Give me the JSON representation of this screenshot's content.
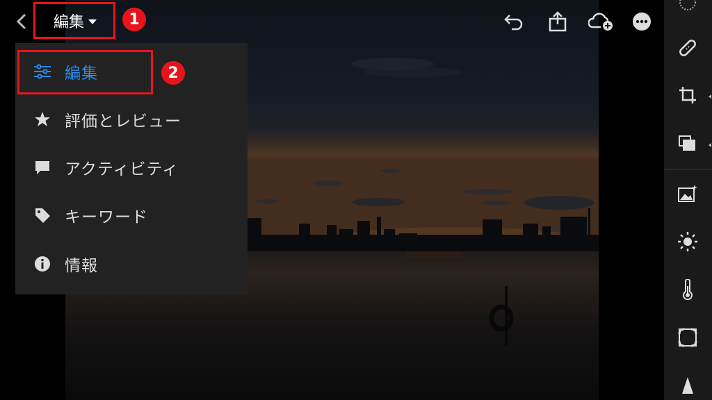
{
  "header": {
    "back_icon": "chevron-left-icon",
    "title": "編集",
    "title_caret_icon": "caret-down-icon",
    "actions": [
      {
        "name": "undo-button",
        "icon": "undo-icon"
      },
      {
        "name": "share-button",
        "icon": "share-icon"
      },
      {
        "name": "cloud-add-button",
        "icon": "cloud-add-icon"
      },
      {
        "name": "more-button",
        "icon": "more-icon"
      }
    ]
  },
  "annotations": {
    "step1": "1",
    "step2": "2",
    "highlight_color": "#e8141c"
  },
  "menu": {
    "items": [
      {
        "label": "編集",
        "icon": "sliders-icon",
        "active": true
      },
      {
        "label": "評価とレビュー",
        "icon": "star-icon",
        "active": false
      },
      {
        "label": "アクティビティ",
        "icon": "comment-icon",
        "active": false
      },
      {
        "label": "キーワード",
        "icon": "tag-icon",
        "active": false
      },
      {
        "label": "情報",
        "icon": "info-icon",
        "active": false
      }
    ],
    "active_color": "#2a8cf0"
  },
  "right_toolbar": {
    "tools": [
      {
        "name": "presets",
        "icon": "presets-icon"
      },
      {
        "name": "healing",
        "icon": "bandage-icon"
      },
      {
        "name": "crop",
        "icon": "crop-icon"
      },
      {
        "name": "versions",
        "icon": "versions-icon"
      },
      {
        "name": "auto",
        "icon": "auto-image-icon"
      },
      {
        "name": "light",
        "icon": "sun-icon"
      },
      {
        "name": "color",
        "icon": "thermometer-icon"
      },
      {
        "name": "effects",
        "icon": "vignette-icon"
      },
      {
        "name": "detail",
        "icon": "triangle-icon"
      }
    ]
  }
}
